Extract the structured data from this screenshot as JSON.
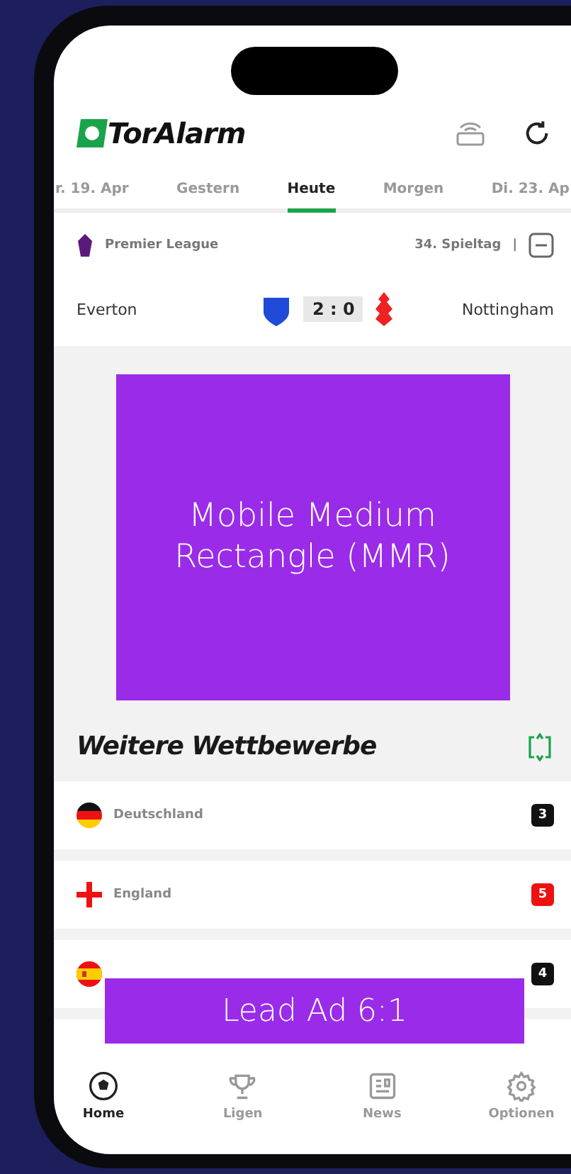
{
  "app": {
    "logo": "TorAlarm"
  },
  "date_tabs": [
    {
      "label": "r. 19. Apr",
      "selected": false
    },
    {
      "label": "Gestern",
      "selected": false
    },
    {
      "label": "Heute",
      "selected": true
    },
    {
      "label": "Morgen",
      "selected": false
    },
    {
      "label": "Di. 23. Ap",
      "selected": false
    }
  ],
  "league": {
    "name": "Premier League",
    "matchday": "34. Spieltag",
    "separator": "|"
  },
  "match": {
    "home": "Everton",
    "score": "2 : 0",
    "away": "Nottingham"
  },
  "ad_medium": {
    "text": "Mobile Medium Rectangle (MMR)"
  },
  "section": {
    "title": "Weitere Wettbewerbe"
  },
  "competitions": [
    {
      "kind": "germany",
      "name": "Deutschland",
      "count": "3",
      "color": "#111111"
    },
    {
      "kind": "england",
      "name": "England",
      "count": "5",
      "color": "#ee1111"
    },
    {
      "kind": "spain",
      "count": "4",
      "color": "#111111"
    }
  ],
  "ad_lead": {
    "text": "Lead Ad 6:1"
  },
  "nav": [
    {
      "kind": "ball",
      "label": "Home",
      "selected": true
    },
    {
      "kind": "trophy",
      "label": "Ligen",
      "selected": false
    },
    {
      "kind": "news",
      "label": "News",
      "selected": false
    },
    {
      "kind": "gear",
      "label": "Optionen",
      "selected": false
    }
  ]
}
